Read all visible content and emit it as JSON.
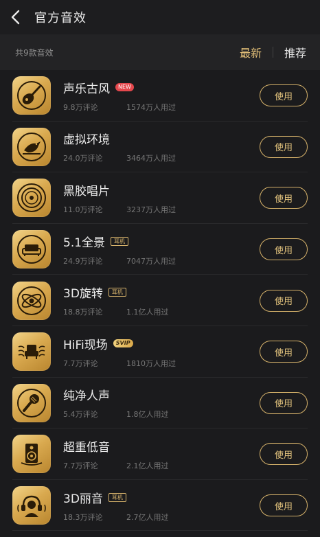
{
  "header": {
    "title": "官方音效"
  },
  "toolbar": {
    "count_text": "共9款音效",
    "sort_latest": "最新",
    "sort_recommend": "推荐",
    "accent": "#e7c37a"
  },
  "use_label": "使用",
  "effects": [
    {
      "name": "声乐古风",
      "badge": "NEW",
      "badge_type": "new",
      "comments": "9.8万评论",
      "users": "1574万人用过",
      "icon": "pipa-icon"
    },
    {
      "name": "虚拟环境",
      "badge": "",
      "badge_type": "",
      "comments": "24.0万评论",
      "users": "3464万人用过",
      "icon": "bird-icon"
    },
    {
      "name": "黑胶唱片",
      "badge": "",
      "badge_type": "",
      "comments": "11.0万评论",
      "users": "3237万人用过",
      "icon": "vinyl-icon"
    },
    {
      "name": "5.1全景",
      "badge": "耳机",
      "badge_type": "ear",
      "comments": "24.9万评论",
      "users": "7047万人用过",
      "icon": "sofa-icon"
    },
    {
      "name": "3D旋转",
      "badge": "耳机",
      "badge_type": "ear",
      "comments": "18.8万评论",
      "users": "1.1亿人用过",
      "icon": "orbit-icon"
    },
    {
      "name": "HiFi现场",
      "badge": "SVIP",
      "badge_type": "svip",
      "comments": "7.7万评论",
      "users": "1810万人用过",
      "icon": "armchair-icon"
    },
    {
      "name": "纯净人声",
      "badge": "",
      "badge_type": "",
      "comments": "5.4万评论",
      "users": "1.8亿人用过",
      "icon": "microphone-icon"
    },
    {
      "name": "超重低音",
      "badge": "",
      "badge_type": "",
      "comments": "7.7万评论",
      "users": "2.1亿人用过",
      "icon": "speaker-icon"
    },
    {
      "name": "3D丽音",
      "badge": "耳机",
      "badge_type": "ear",
      "comments": "18.3万评论",
      "users": "2.7亿人用过",
      "icon": "headphones-person-icon"
    }
  ]
}
